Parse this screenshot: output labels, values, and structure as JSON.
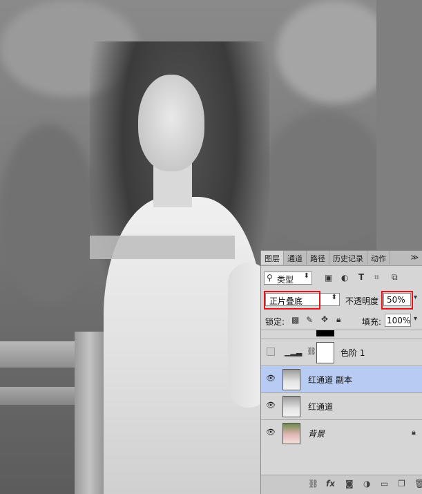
{
  "panel": {
    "tabs": [
      {
        "label": "图层",
        "active": true
      },
      {
        "label": "通道",
        "active": false
      },
      {
        "label": "路径",
        "active": false
      },
      {
        "label": "历史记录",
        "active": false
      },
      {
        "label": "动作",
        "active": false
      }
    ],
    "filter": {
      "kind_label": "类型",
      "icons": [
        "image-filter-icon",
        "adjustment-filter-icon",
        "type-filter-icon",
        "shape-filter-icon",
        "smart-object-filter-icon"
      ]
    },
    "blend": {
      "mode_value": "正片叠底",
      "opacity_label": "不透明度",
      "opacity_value": "50%"
    },
    "lock": {
      "label": "锁定:",
      "fill_label": "填充:",
      "fill_value": "100%"
    },
    "layers": [
      {
        "name": "色阶 1",
        "visible": false,
        "selected": false,
        "type": "adjustment"
      },
      {
        "name": "红通道 副本",
        "visible": true,
        "selected": true,
        "type": "pixel"
      },
      {
        "name": "红通道",
        "visible": true,
        "selected": false,
        "type": "pixel"
      },
      {
        "name": "背景",
        "visible": true,
        "selected": false,
        "type": "background",
        "locked": true
      }
    ],
    "bottom_icons": [
      "link-icon",
      "fx-icon",
      "mask-icon",
      "adjustment-icon",
      "group-folder-icon",
      "new-layer-icon",
      "trash-icon"
    ]
  },
  "colors": {
    "highlight": "#e3141c",
    "selected_row": "#b7cbf3"
  }
}
